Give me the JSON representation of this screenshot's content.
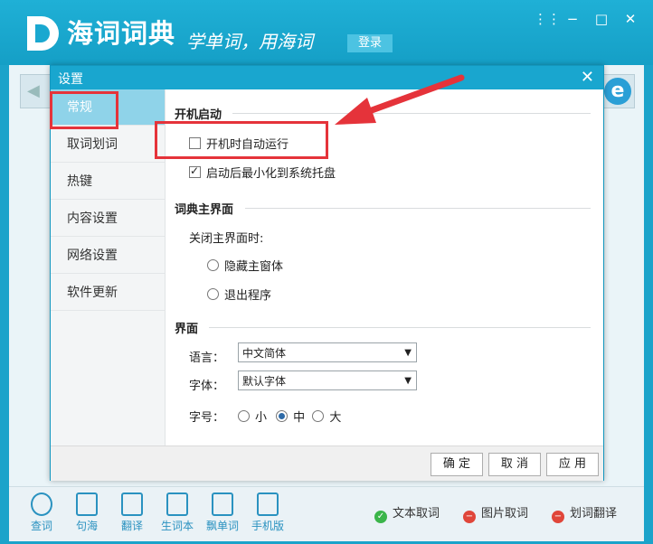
{
  "app": {
    "title": "海词词典",
    "slogan": "学单词，用海词",
    "login_label": "登录"
  },
  "window_controls": {
    "menu": "⋮⋮",
    "minimize": "−",
    "maximize": "□",
    "close": "✕"
  },
  "dialog": {
    "title": "设置",
    "close": "✕",
    "nav": [
      {
        "label": "常规"
      },
      {
        "label": "取词划词"
      },
      {
        "label": "热键"
      },
      {
        "label": "内容设置"
      },
      {
        "label": "网络设置"
      },
      {
        "label": "软件更新"
      }
    ],
    "startup": {
      "title": "开机启动",
      "auto_run": {
        "label": "开机时自动运行",
        "checked": false
      },
      "minimize_tray": {
        "label": "启动后最小化到系统托盘",
        "checked": true
      }
    },
    "main_ui": {
      "title": "词典主界面",
      "close_label": "关闭主界面时:",
      "hide": {
        "label": "隐藏主窗体",
        "selected": false
      },
      "exit": {
        "label": "退出程序",
        "selected": false
      }
    },
    "interface": {
      "title": "界面",
      "language_label": "语言：",
      "language_value": "中文简体",
      "font_label": "字体：",
      "font_value": "默认字体",
      "size_label": "字号：",
      "sizes": [
        {
          "label": "小",
          "selected": false
        },
        {
          "label": "中",
          "selected": true
        },
        {
          "label": "大",
          "selected": false
        }
      ]
    },
    "buttons": {
      "ok": "确 定",
      "cancel": "取 消",
      "apply": "应 用"
    }
  },
  "bottom": {
    "tools": [
      {
        "label": "查词",
        "active": true
      },
      {
        "label": "句海"
      },
      {
        "label": "翻译"
      },
      {
        "label": "生词本"
      },
      {
        "label": "飘单词"
      },
      {
        "label": "手机版"
      }
    ],
    "status": [
      {
        "label": "文本取词",
        "state": "on",
        "color": "#3bb54a"
      },
      {
        "label": "图片取词",
        "state": "off",
        "color": "#e0463a"
      },
      {
        "label": "划词翻译",
        "state": "off",
        "color": "#e0463a"
      }
    ]
  },
  "colors": {
    "accent": "#1ba3ca",
    "annotation": "#e5333a"
  }
}
